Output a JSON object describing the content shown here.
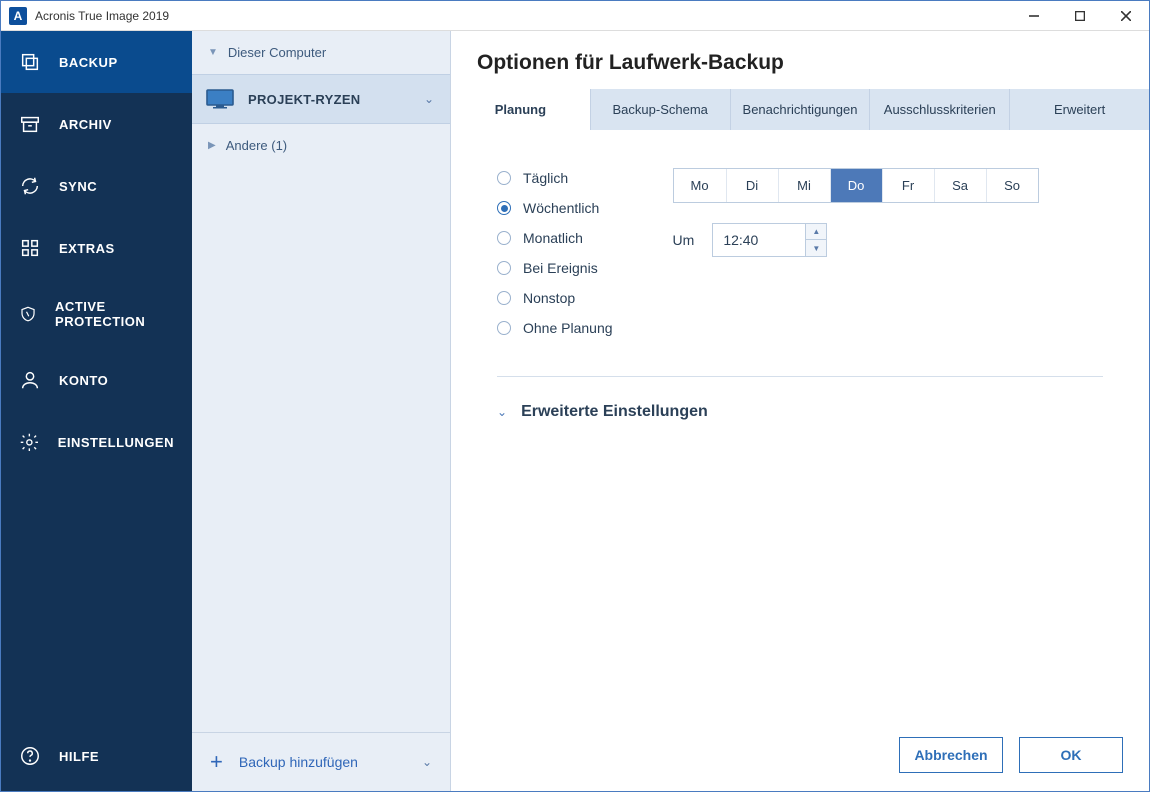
{
  "app": {
    "title": "Acronis True Image 2019",
    "icon_letter": "A"
  },
  "sidebar": {
    "items": [
      {
        "label": "BACKUP",
        "icon": "backup"
      },
      {
        "label": "ARCHIV",
        "icon": "archive"
      },
      {
        "label": "SYNC",
        "icon": "sync"
      },
      {
        "label": "EXTRAS",
        "icon": "extras"
      },
      {
        "label": "ACTIVE PROTECTION",
        "icon": "shield"
      },
      {
        "label": "KONTO",
        "icon": "account"
      },
      {
        "label": "EINSTELLUNGEN",
        "icon": "settings"
      }
    ],
    "help_label": "HILFE"
  },
  "listpanel": {
    "header": "Dieser Computer",
    "item_label": "PROJEKT-RYZEN",
    "other_label": "Andere (1)",
    "add_label": "Backup hinzufügen"
  },
  "content": {
    "title": "Optionen für Laufwerk-Backup",
    "tabs": [
      "Planung",
      "Backup-Schema",
      "Benachrichtigungen",
      "Ausschlusskriterien",
      "Erweitert"
    ],
    "radios": [
      "Täglich",
      "Wöchentlich",
      "Monatlich",
      "Bei Ereignis",
      "Nonstop",
      "Ohne Planung"
    ],
    "selected_radio": 1,
    "days": [
      "Mo",
      "Di",
      "Mi",
      "Do",
      "Fr",
      "Sa",
      "So"
    ],
    "selected_day": 3,
    "time_label": "Um",
    "time_value": "12:40",
    "advanced_label": "Erweiterte Einstellungen",
    "cancel_label": "Abbrechen",
    "ok_label": "OK"
  }
}
